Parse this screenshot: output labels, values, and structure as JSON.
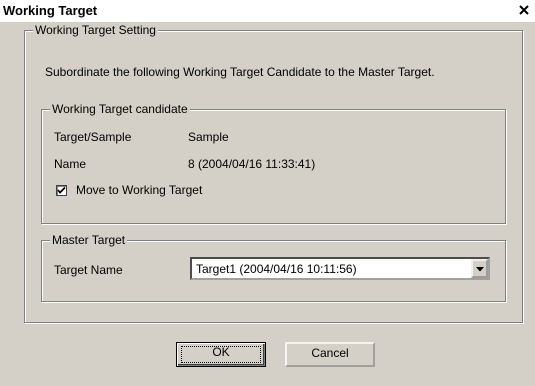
{
  "window": {
    "title": "Working Target",
    "close_glyph": "✕"
  },
  "setting_group": {
    "label": "Working Target Setting",
    "description": "Subordinate the following Working Target Candidate to the Master Target."
  },
  "candidate_group": {
    "label": "Working Target candidate",
    "rows": [
      {
        "label": "Target/Sample",
        "value": "Sample"
      },
      {
        "label": "Name",
        "value": "8 (2004/04/16 11:33:41)"
      }
    ],
    "checkbox": {
      "label": "Move to Working Target",
      "checked": true
    }
  },
  "master_group": {
    "label": "Master Target",
    "target_name_label": "Target Name",
    "target_name_value": "Target1 (2004/04/16 10:11:56)"
  },
  "buttons": {
    "ok": "OK",
    "cancel": "Cancel"
  },
  "icons": {
    "close": "close-icon",
    "check": "checkmark-icon",
    "dropdown": "chevron-down-icon"
  }
}
